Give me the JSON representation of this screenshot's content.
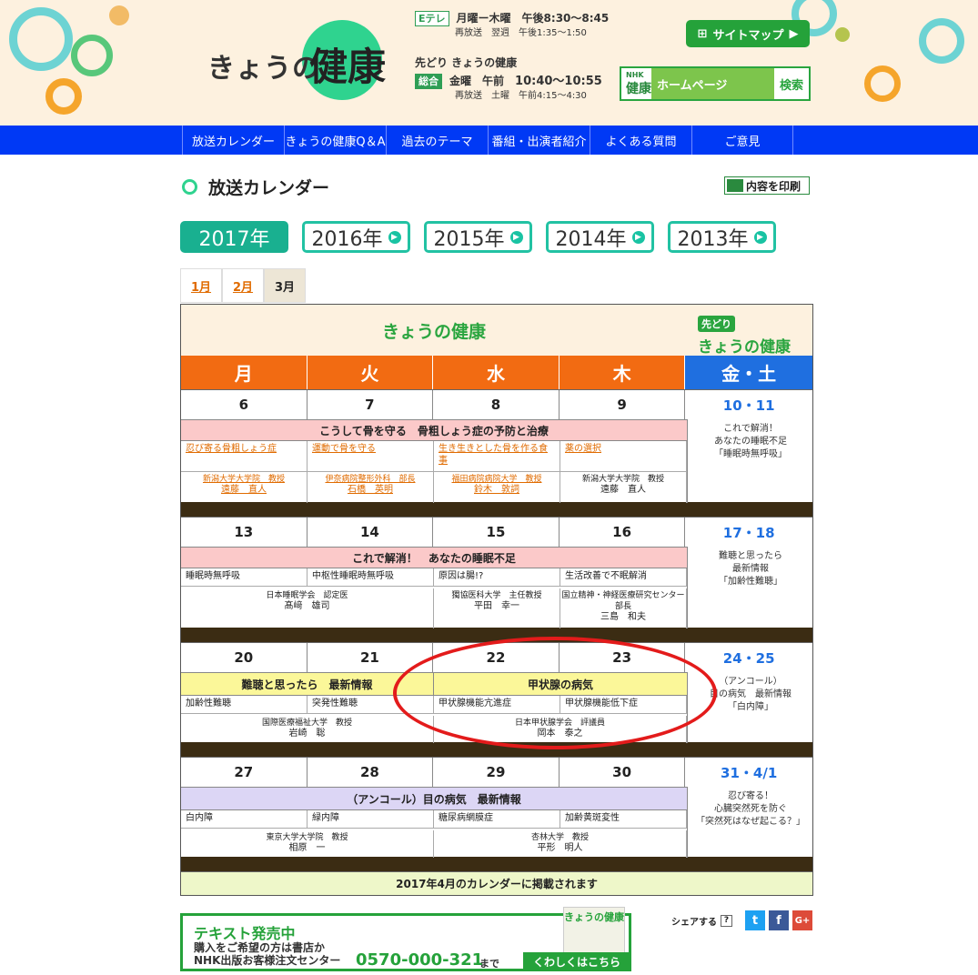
{
  "header": {
    "logo_prefix": "きょうの",
    "logo_kanji": "健康",
    "etele_badge": "Eテレ",
    "etele_days": "月曜ー木曜",
    "etele_time": "午後8:30〜8:45",
    "etele_rerun": "再放送　翌週　午後1:35〜1:50",
    "saki_title": "先どり きょうの健康",
    "sogo_badge": "総合",
    "sogo_days": "金曜　午前",
    "sogo_time": "10:40〜10:55",
    "sogo_rerun": "再放送　土曜　午前4:15〜4:30",
    "sitemap_label": "サイトマップ",
    "hp_nhk": "NHK",
    "hp_kenko": "健康",
    "hp_mid": "ホームページ",
    "hp_search": "検索"
  },
  "nav": [
    "放送カレンダー",
    "きょうの健康Q＆A",
    "過去のテーマ",
    "番組・出演者紹介",
    "よくある質問",
    "ご意見"
  ],
  "page": {
    "title": "放送カレンダー",
    "print_label": "内容を印刷",
    "years": [
      "2017年",
      "2016年",
      "2015年",
      "2014年",
      "2013年"
    ],
    "months": [
      "1月",
      "2月",
      "3月"
    ]
  },
  "calendar": {
    "title": "きょうの健康",
    "saki_tag": "先どり",
    "saki_title": "きょうの健康",
    "days": [
      "月",
      "火",
      "水",
      "木",
      "金・土"
    ],
    "footer": "2017年4月のカレンダーに掲載されます",
    "weeks": [
      {
        "dates": [
          "6",
          "7",
          "8",
          "9",
          "10・11"
        ],
        "theme": "こうして骨を守る　骨粗しょう症の予防と治療",
        "topics": [
          "忍び寄る骨粗しょう症",
          "運動で骨を守る",
          "生き生きとした骨を作る食事",
          "薬の選択"
        ],
        "g1_aff": "新潟大学大学院　教授",
        "g1_name": "遠藤　直人",
        "g2_aff": "伊奈病院整形外科　部長",
        "g2_name": "石橋　英明",
        "g3_aff": "福田病院病院大学　教授",
        "g3_name": "鈴木　敦詞",
        "g4_aff": "新潟大学大学院　教授",
        "g4_name": "遠藤　直人",
        "fs": [
          "これで解消！",
          "あなたの睡眠不足",
          "「睡眠時無呼吸」"
        ]
      },
      {
        "dates": [
          "13",
          "14",
          "15",
          "16",
          "17・18"
        ],
        "theme": "これで解消！　あなたの睡眠不足",
        "topics": [
          "睡眠時無呼吸",
          "中枢性睡眠時無呼吸",
          "原因は腸!?",
          "生活改善で不眠解消"
        ],
        "g1_aff": "日本睡眠学会　認定医",
        "g1_name": "髙﨑　雄司",
        "g2_aff": "獨協医科大学　主任教授",
        "g2_name": "平田　幸一",
        "g3_aff": "国立精神・神経医療研究センター",
        "g3_aff2": "部長",
        "g3_name": "三島　和夫",
        "fs": [
          "難聴と思ったら",
          "最新情報",
          "「加齢性難聴」"
        ]
      },
      {
        "dates": [
          "20",
          "21",
          "22",
          "23",
          "24・25"
        ],
        "theme1": "難聴と思ったら　最新情報",
        "theme2": "甲状腺の病気",
        "topics": [
          "加齢性難聴",
          "突発性難聴",
          "甲状腺機能亢進症",
          "甲状腺機能低下症"
        ],
        "g1_aff": "国際医療福祉大学　教授",
        "g1_name": "岩崎　聡",
        "g2_aff": "日本甲状腺学会　評議員",
        "g2_name": "岡本　泰之",
        "fs": [
          "（アンコール）",
          "目の病気　最新情報",
          "「白内障」"
        ]
      },
      {
        "dates": [
          "27",
          "28",
          "29",
          "30",
          "31・4/1"
        ],
        "theme": "（アンコール）目の病気　最新情報",
        "topics": [
          "白内障",
          "緑内障",
          "糖尿病網膜症",
          "加齢黄斑変性"
        ],
        "g1_aff": "東京大学大学院　教授",
        "g1_name": "相原　一",
        "g2_aff": "杏林大学　教授",
        "g2_name": "平形　明人",
        "fs": [
          "忍び寄る！",
          "心臓突然死を防ぐ",
          "「突然死はなぜ起こる？」"
        ]
      }
    ]
  },
  "banner": {
    "t1": "テキスト発売中",
    "t2a": "購入をご希望の方は書店か",
    "t2b": "NHK出版お客様注文センター",
    "tel": "0570-000-321",
    "made": "まで",
    "cover": "きょうの健康",
    "more": "くわしくはこちら"
  },
  "share": {
    "label": "シェアする",
    "q": "?",
    "tw": "t",
    "fb": "f",
    "gp": "G+"
  },
  "colors": {
    "nav": "#0039f5",
    "orange": "#f26b12",
    "blue": "#1f6fe0",
    "green": "#2aa53f",
    "pink": "#fbc9c9",
    "yellow": "#fbf799",
    "lavender": "#dcd6f5"
  }
}
